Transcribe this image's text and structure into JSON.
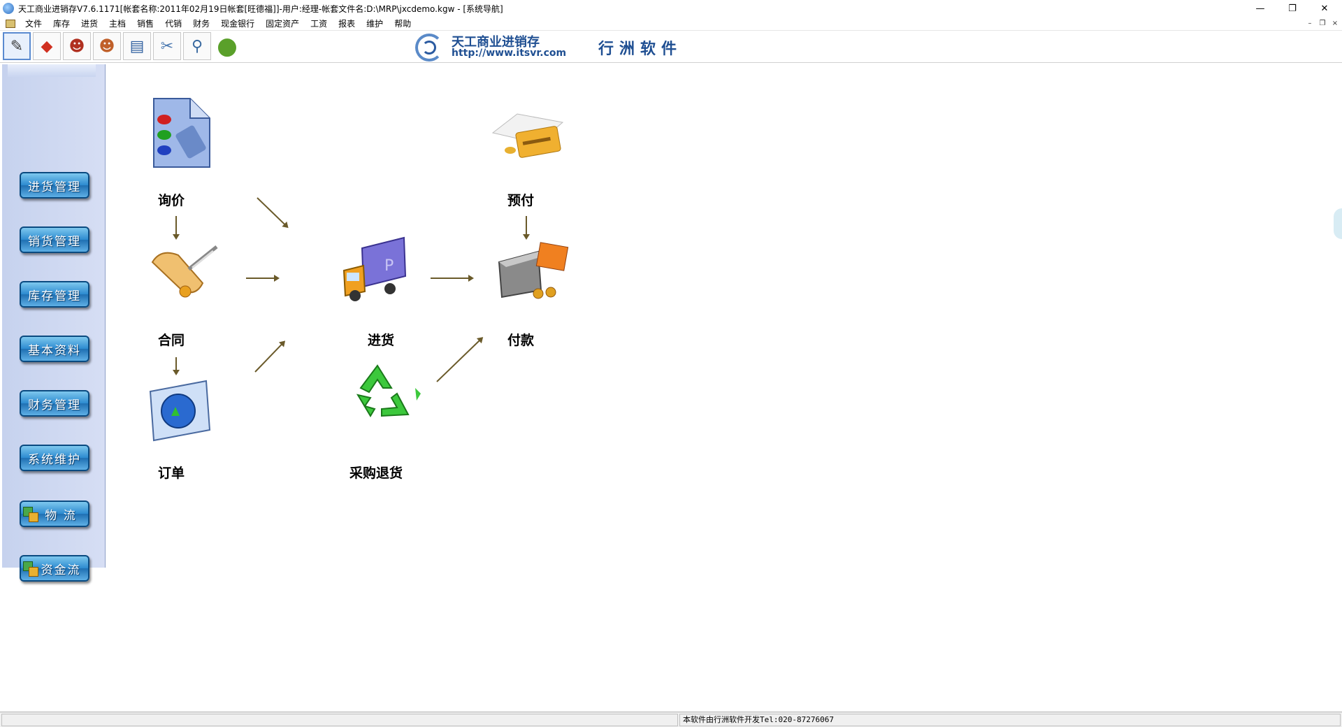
{
  "window": {
    "title": "天工商业进销存V7.6.1171[帐套名称:2011年02月19日帐套[旺德福]]-用户:经理-帐套文件名:D:\\MRP\\jxcdemo.kgw - [系统导航]",
    "controls": {
      "minimize": "—",
      "restore": "❐",
      "close": "✕"
    }
  },
  "menu": {
    "items": [
      "文件",
      "库存",
      "进货",
      "主档",
      "销售",
      "代销",
      "财务",
      "现金银行",
      "固定资产",
      "工资",
      "报表",
      "维护",
      "帮助"
    ],
    "mdi_controls": {
      "minimize": "–",
      "restore": "❐",
      "close": "×"
    }
  },
  "toolbar": {
    "buttons": [
      {
        "icon": "pen-tool-icon",
        "glyph": "✎",
        "color": "#3a3a3a",
        "active": true
      },
      {
        "icon": "blocks-icon",
        "glyph": "◆",
        "color": "#d03020"
      },
      {
        "icon": "user-icon",
        "glyph": "☻",
        "color": "#b03020"
      },
      {
        "icon": "users-icon",
        "glyph": "☻",
        "color": "#c0602a"
      },
      {
        "icon": "report-search-icon",
        "glyph": "▤",
        "color": "#3060a0"
      },
      {
        "icon": "tools-icon",
        "glyph": "✂",
        "color": "#4a78b0"
      },
      {
        "icon": "magnifier-icon",
        "glyph": "⚲",
        "color": "#3a6aa0"
      },
      {
        "icon": "leaf-globe-icon",
        "glyph": "●",
        "color": "#5aa02a"
      }
    ]
  },
  "banner": {
    "company_name": "天工商业进销存",
    "url": "http://www.itsvr.com",
    "brand": "行洲软件"
  },
  "sidebar": {
    "items": [
      {
        "label": "进货管理",
        "has_icon": false
      },
      {
        "label": "销货管理",
        "has_icon": false
      },
      {
        "label": "库存管理",
        "has_icon": false
      },
      {
        "label": "基本资料",
        "has_icon": false
      },
      {
        "label": "财务管理",
        "has_icon": false
      },
      {
        "label": "系统维护",
        "has_icon": false
      },
      {
        "label": "物 流",
        "has_icon": true
      },
      {
        "label": "资金流",
        "has_icon": true
      }
    ]
  },
  "workflow": {
    "nodes": {
      "inquiry": {
        "label": "询价",
        "icon": "numbered-list-document-icon"
      },
      "prepay": {
        "label": "预付",
        "icon": "credit-card-icon"
      },
      "contract": {
        "label": "合同",
        "icon": "scroll-quill-icon"
      },
      "purchase": {
        "label": "进货",
        "icon": "delivery-truck-icon"
      },
      "payment": {
        "label": "付款",
        "icon": "cash-register-icon"
      },
      "order": {
        "label": "订单",
        "icon": "globe-monitor-icon"
      },
      "purchase_return": {
        "label": "采购退货",
        "icon": "recycle-icon"
      }
    }
  },
  "statusbar": {
    "left": "",
    "right": "本软件由行洲软件开发Tel:020-87276067"
  },
  "colors": {
    "nav_button": "#2c8ad0",
    "sidebar_bg": "#c6d2ee",
    "brand_blue": "#1f4f92",
    "arrow": "#6a5a2a"
  }
}
